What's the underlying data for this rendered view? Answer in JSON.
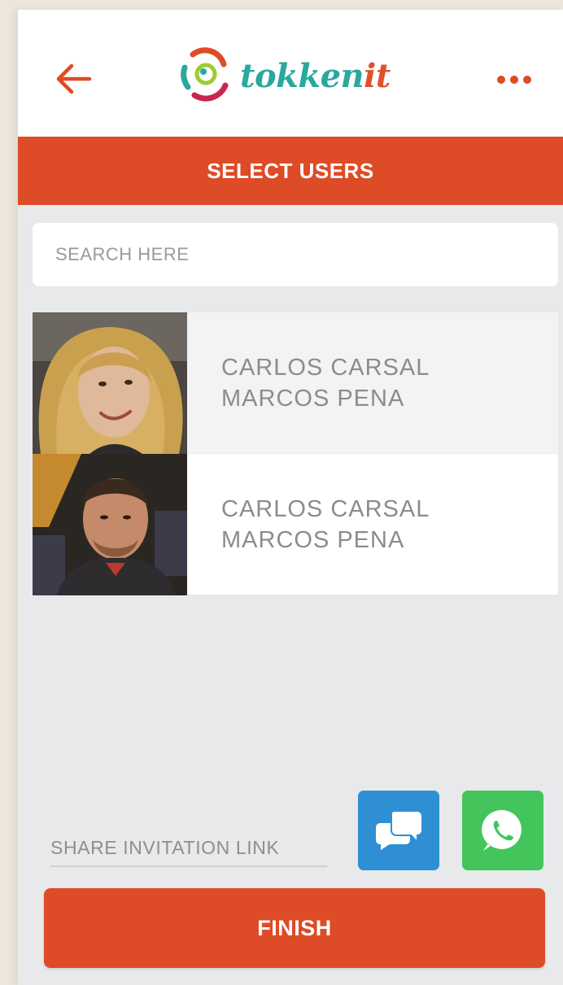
{
  "header": {
    "back_icon": "arrow-left-icon",
    "more_icon": "more-dots-icon",
    "logo": {
      "part1": "tokken",
      "part2": "it"
    }
  },
  "title_bar": {
    "label": "SELECT USERS"
  },
  "search": {
    "placeholder": "SEARCH HERE",
    "value": ""
  },
  "users": [
    {
      "line1": "CARLOS CARSAL",
      "line2": "MARCOS PENA",
      "avatar": "woman-photo"
    },
    {
      "line1": "CARLOS CARSAL",
      "line2": "MARCOS PENA",
      "avatar": "man-photo"
    }
  ],
  "share": {
    "label": "SHARE INVITATION LINK",
    "chat_icon": "chat-bubbles-icon",
    "whatsapp_icon": "whatsapp-icon"
  },
  "finish": {
    "label": "FINISH"
  },
  "colors": {
    "accent": "#dd4b27",
    "teal": "#2aa89e",
    "chat_blue": "#2f8fd4",
    "whatsapp_green": "#43c55c",
    "page_bg": "#e8e9eb"
  }
}
